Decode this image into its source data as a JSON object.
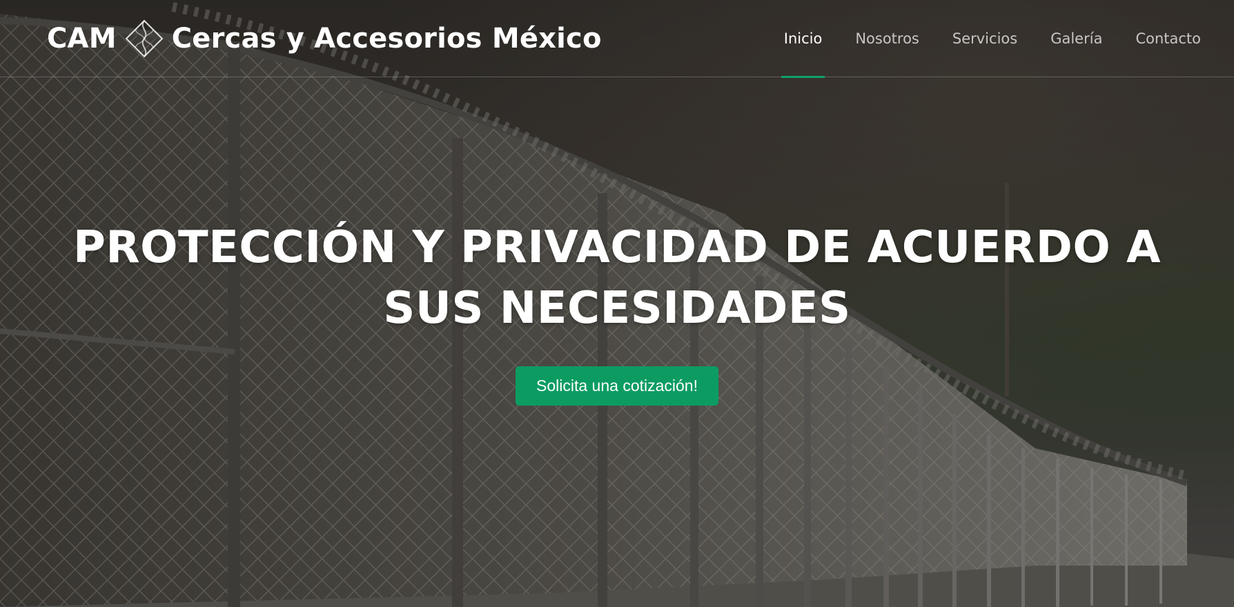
{
  "header": {
    "brand_prefix": "CAM",
    "brand_name": "Cercas y Accesorios México",
    "logo_icon": "chain-link-diamond-icon",
    "nav": [
      {
        "label": "Inicio",
        "active": true
      },
      {
        "label": "Nosotros",
        "active": false
      },
      {
        "label": "Servicios",
        "active": false
      },
      {
        "label": "Galería",
        "active": false
      },
      {
        "label": "Contacto",
        "active": false
      }
    ]
  },
  "hero": {
    "title": "PROTECCIÓN Y PRIVACIDAD DE ACUERDO A SUS NECESIDADES",
    "cta_label": "Solicita una cotización!",
    "background_subject": "chain-link fence with razor wire along hillside"
  },
  "colors": {
    "accent": "#0c9c62",
    "nav_active_underline": "#0fa06b",
    "text": "#ffffff"
  }
}
